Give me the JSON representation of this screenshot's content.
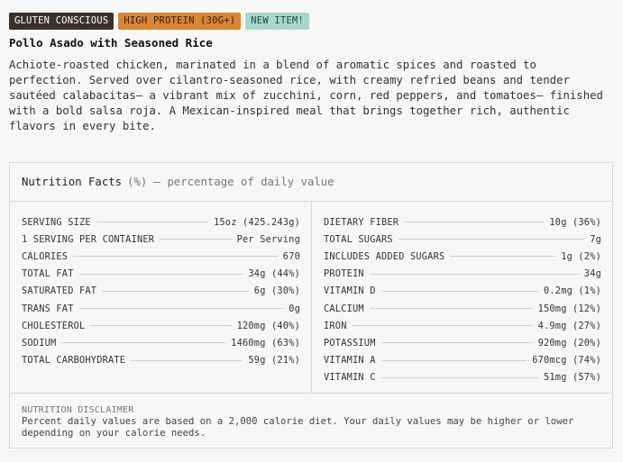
{
  "badges": [
    {
      "label": "GLUTEN CONSCIOUS",
      "color": "#3a312a"
    },
    {
      "label": "HIGH PROTEIN (30G+)",
      "color": "#d9843b"
    },
    {
      "label": "NEW ITEM!",
      "color": "#a9d6cc"
    }
  ],
  "meal": {
    "title": "Pollo Asado with Seasoned Rice",
    "description": "Achiote-roasted chicken, marinated in a blend of aromatic spices and roasted to perfection. Served over cilantro-seasoned rice, with creamy refried beans and tender sautéed calabacitas— a vibrant mix of zucchini, corn, red peppers, and tomatoes— finished with a bold salsa roja. A Mexican-inspired meal that brings together rich, authentic flavors in every bite."
  },
  "nutrition": {
    "heading": "Nutrition Facts",
    "subheading": "(%) – percentage of daily value",
    "left": [
      {
        "label": "SERVING SIZE",
        "value": "15oz (425.243g)"
      },
      {
        "label": "1 SERVING PER CONTAINER",
        "value": "Per Serving"
      },
      {
        "label": "CALORIES",
        "value": "670"
      },
      {
        "label": "TOTAL FAT",
        "value": "34g (44%)"
      },
      {
        "label": "SATURATED FAT",
        "value": "6g (30%)"
      },
      {
        "label": "TRANS FAT",
        "value": "0g"
      },
      {
        "label": "CHOLESTEROL",
        "value": "120mg (40%)"
      },
      {
        "label": "SODIUM",
        "value": "1460mg (63%)"
      },
      {
        "label": "TOTAL CARBOHYDRATE",
        "value": "59g (21%)"
      }
    ],
    "right": [
      {
        "label": "DIETARY FIBER",
        "value": "10g (36%)"
      },
      {
        "label": "TOTAL SUGARS",
        "value": "7g"
      },
      {
        "label": "INCLUDES ADDED SUGARS",
        "value": "1g (2%)"
      },
      {
        "label": "PROTEIN",
        "value": "34g"
      },
      {
        "label": "VITAMIN D",
        "value": "0.2mg (1%)"
      },
      {
        "label": "CALCIUM",
        "value": "150mg (12%)"
      },
      {
        "label": "IRON",
        "value": "4.9mg (27%)"
      },
      {
        "label": "POTASSIUM",
        "value": "920mg (20%)"
      },
      {
        "label": "VITAMIN A",
        "value": "670mcg (74%)"
      },
      {
        "label": "VITAMIN C",
        "value": "51mg (57%)"
      }
    ],
    "disclaimer_title": "NUTRITION DISCLAIMER",
    "disclaimer_text": "Percent daily values are based on a 2,000 calorie diet. Your daily values may be higher or lower depending on your calorie needs."
  }
}
